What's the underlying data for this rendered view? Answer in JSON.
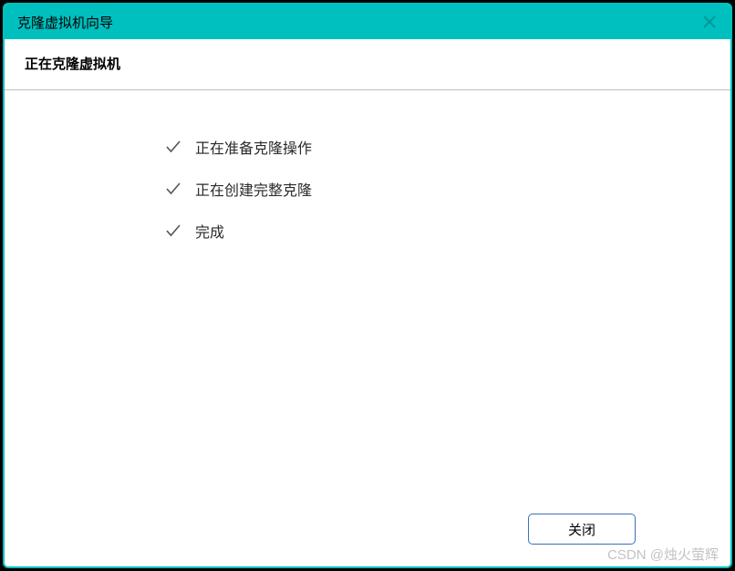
{
  "titlebar": {
    "title": "克隆虚拟机向导"
  },
  "header": {
    "title": "正在克隆虚拟机"
  },
  "steps": [
    {
      "label": "正在准备克隆操作"
    },
    {
      "label": "正在创建完整克隆"
    },
    {
      "label": "完成"
    }
  ],
  "footer": {
    "close_label": "关闭"
  },
  "watermark": "CSDN @烛火萤辉"
}
